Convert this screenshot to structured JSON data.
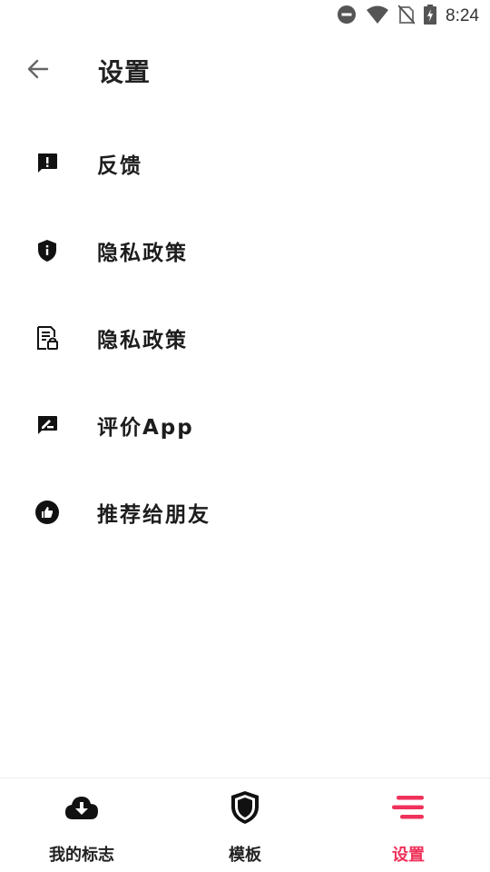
{
  "status_bar": {
    "time": "8:24",
    "icons": [
      "do-not-disturb-icon",
      "wifi-icon",
      "no-sim-icon",
      "battery-charging-icon"
    ]
  },
  "header": {
    "back_icon": "arrow-left-icon",
    "title": "设置"
  },
  "menu": {
    "items": [
      {
        "label": "反馈",
        "icon": "feedback-icon"
      },
      {
        "label": "隐私政策",
        "icon": "privacy-shield-icon"
      },
      {
        "label": "隐私政策",
        "icon": "policy-document-icon"
      },
      {
        "label": "评价App",
        "icon": "rate-app-icon"
      },
      {
        "label": "推荐给朋友",
        "icon": "thumb-up-icon"
      }
    ]
  },
  "bottom_nav": {
    "items": [
      {
        "label": "我的标志",
        "icon": "cloud-download-icon",
        "active": false
      },
      {
        "label": "模板",
        "icon": "shield-icon",
        "active": false
      },
      {
        "label": "设置",
        "icon": "menu-lines-icon",
        "active": true
      }
    ]
  },
  "colors": {
    "accent": "#f0325a",
    "text": "#1d1d1d",
    "icon": "#111111"
  }
}
